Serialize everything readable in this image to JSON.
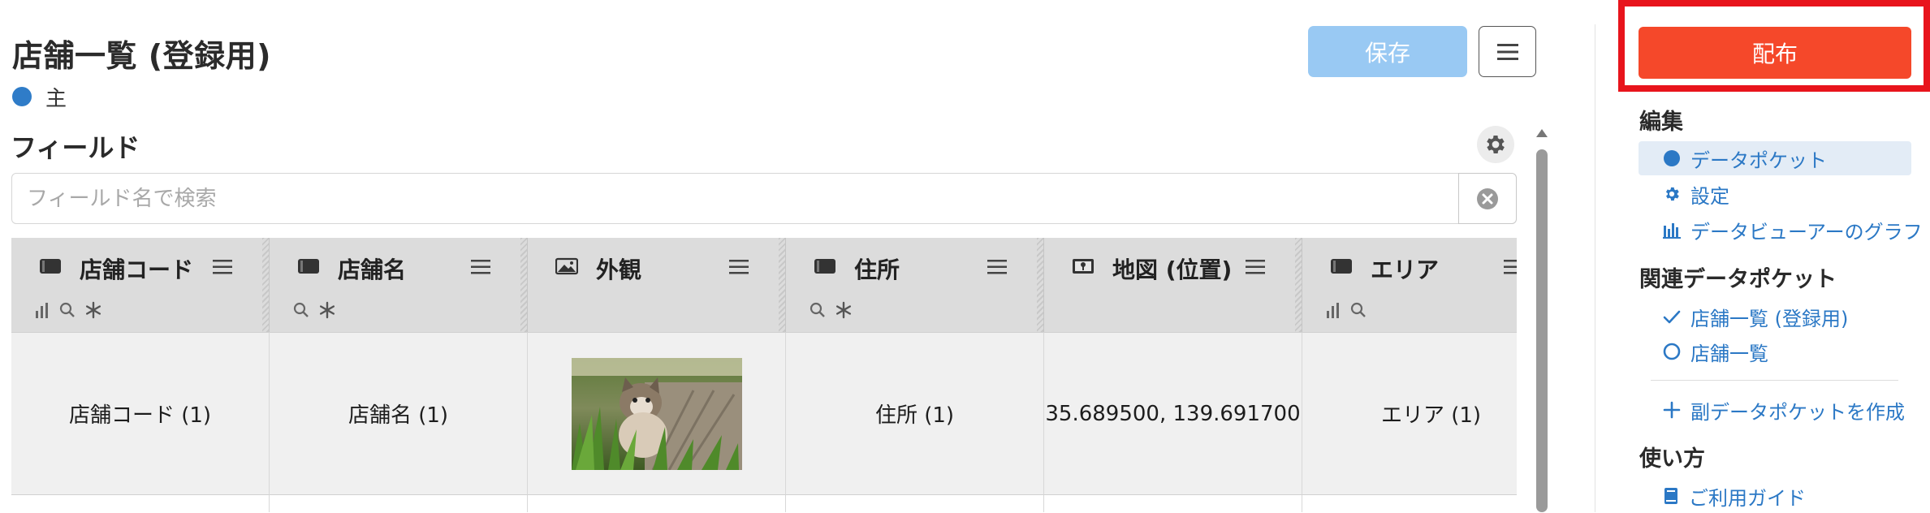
{
  "header": {
    "title": "店舗一覧 (登録用)",
    "main_label": "主",
    "save_label": "保存"
  },
  "fields": {
    "heading": "フィールド",
    "search_placeholder": "フィールド名で検索",
    "columns": [
      {
        "type_icon": "text-field-icon",
        "label": "店舗コード",
        "flags": [
          "bar-chart-icon",
          "search-icon",
          "star-icon"
        ],
        "cell": "店舗コード (1)"
      },
      {
        "type_icon": "text-field-icon",
        "label": "店舗名",
        "flags": [
          "search-icon",
          "star-icon"
        ],
        "cell": "店舗名 (1)"
      },
      {
        "type_icon": "image-field-icon",
        "label": "外観",
        "flags": [],
        "cell_image": "kitten-photo"
      },
      {
        "type_icon": "text-field-icon",
        "label": "住所",
        "flags": [
          "search-icon",
          "star-icon"
        ],
        "cell": "住所 (1)"
      },
      {
        "type_icon": "map-field-icon",
        "label": "地図 (位置)",
        "flags": [],
        "cell": "35.689500, 139.691700"
      },
      {
        "type_icon": "text-field-icon",
        "label": "エリア",
        "flags": [
          "bar-chart-icon",
          "search-icon"
        ],
        "cell": "エリア (1)"
      }
    ]
  },
  "panel": {
    "distribute_label": "配布",
    "edit_heading": "編集",
    "edit_items": [
      {
        "icon": "circle-dot-icon",
        "label": "データポケット",
        "active": true
      },
      {
        "icon": "gear-icon",
        "label": "設定"
      },
      {
        "icon": "bar-chart-icon",
        "label": "データビューアーのグラフ"
      }
    ],
    "related_heading": "関連データポケット",
    "related_items": [
      {
        "icon": "check-icon",
        "label": "店舗一覧 (登録用)"
      },
      {
        "icon": "circle-ring-icon",
        "label": "店舗一覧"
      }
    ],
    "create_sub_label": "副データポケットを作成",
    "usage_heading": "使い方",
    "guide_label": "ご利用ガイド"
  },
  "colors": {
    "accent_blue": "#2b78c5",
    "save_disabled": "#99c9f3",
    "distribute_orange": "#f5482a",
    "highlight_red": "#e8141c"
  }
}
